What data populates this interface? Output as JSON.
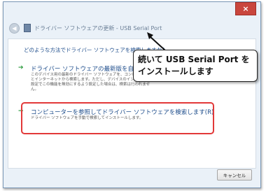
{
  "window": {
    "title": "ドライバー ソフトウェアの更新 - USB Serial Port",
    "close_label": "×"
  },
  "main": {
    "question": "どのような方法でドライバー ソフトウェアを検索しますか?",
    "options": [
      {
        "title": "ドライバー ソフトウェアの最新版を自動",
        "description": "このデバイス用の最新のドライバー ソフトウェアを、コンピューターとインターネットから検索します。ただし、デバイスのインストール設定でこの機能を無効にするよう設定した場合は、検索は行われません。"
      },
      {
        "title": "コンピューターを参照してドライバー ソフトウェアを検索します(R)",
        "description": "ドライバー ソフトウェアを手動で検索してインストールします。"
      }
    ]
  },
  "footer": {
    "cancel_label": "キャンセル"
  },
  "callout": {
    "line1": "続いて USB Serial Port を",
    "line2": "インストールします"
  },
  "colors": {
    "highlight": "#e23939",
    "link_text": "#1f4e8c",
    "option_arrow": "#2a9a3c",
    "close_button": "#c9463d"
  }
}
